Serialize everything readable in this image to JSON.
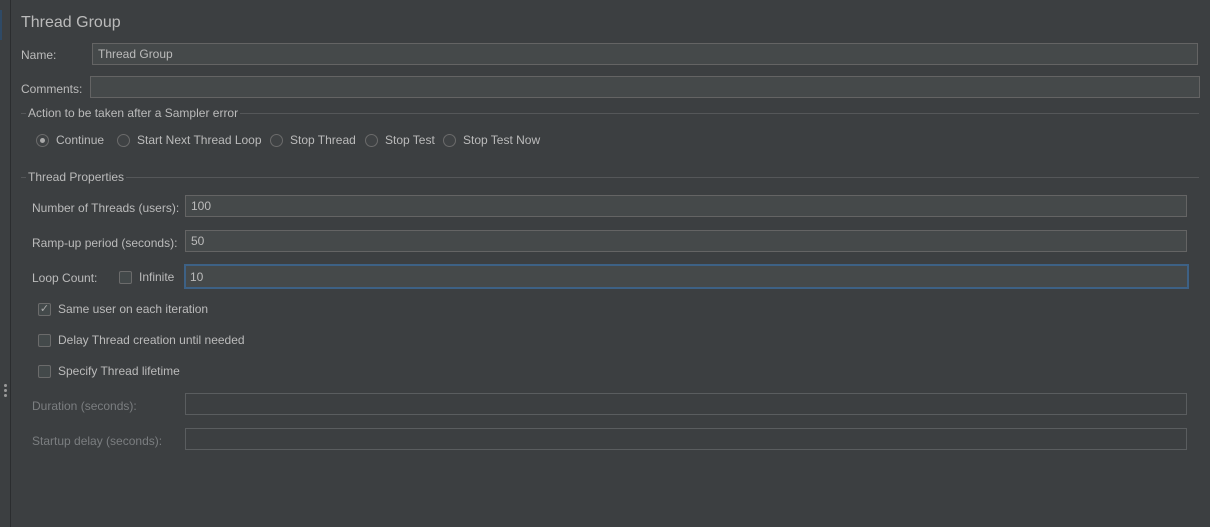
{
  "panel": {
    "title": "Thread Group",
    "name_label": "Name:",
    "name_value": "Thread Group",
    "comments_label": "Comments:",
    "comments_value": ""
  },
  "sampler_error": {
    "legend": "Action to be taken after a Sampler error",
    "options": [
      {
        "label": "Continue",
        "selected": true
      },
      {
        "label": "Start Next Thread Loop",
        "selected": false
      },
      {
        "label": "Stop Thread",
        "selected": false
      },
      {
        "label": "Stop Test",
        "selected": false
      },
      {
        "label": "Stop Test Now",
        "selected": false
      }
    ]
  },
  "thread_properties": {
    "legend": "Thread Properties",
    "threads_label": "Number of Threads (users):",
    "threads_value": "100",
    "rampup_label": "Ramp-up period (seconds):",
    "rampup_value": "50",
    "loop_label": "Loop Count:",
    "infinite_label": "Infinite",
    "infinite_checked": false,
    "loop_value": "10",
    "same_user_label": "Same user on each iteration",
    "same_user_checked": true,
    "delay_label": "Delay Thread creation until needed",
    "delay_checked": false,
    "lifetime_label": "Specify Thread lifetime",
    "lifetime_checked": false,
    "duration_label": "Duration (seconds):",
    "duration_value": "",
    "startup_label": "Startup delay (seconds):",
    "startup_value": ""
  },
  "icons": {
    "checkmark": "✓"
  }
}
